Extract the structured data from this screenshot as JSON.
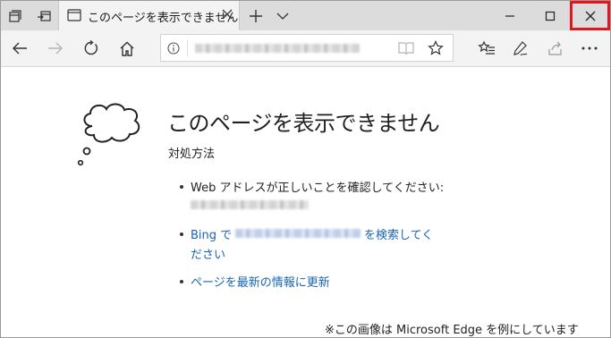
{
  "tab": {
    "title": "このページを表示できません"
  },
  "address": {
    "url": ""
  },
  "content": {
    "title": "このページを表示できません",
    "subtitle": "対処方法",
    "item1": "Web アドレスが正しいことを確認してください:",
    "item2_prefix": "Bing で",
    "item2_suffix": "を検索してく",
    "item2_line2": "ださい",
    "item3": "ページを最新の情報に更新"
  },
  "footnote": "※この画像は Microsoft Edge を例にしています",
  "colors": {
    "link": "#1764b5",
    "highlight": "#e2161e"
  },
  "icons": [
    "tab-manager-icon",
    "set-aside-tabs-icon",
    "page-icon",
    "tab-close-icon",
    "new-tab-icon",
    "tab-preview-chevron-icon",
    "minimize-icon",
    "maximize-icon",
    "close-icon",
    "back-icon",
    "forward-icon",
    "refresh-icon",
    "home-icon",
    "info-icon",
    "reading-view-icon",
    "favorite-star-icon",
    "favorites-hub-icon",
    "web-note-icon",
    "share-icon",
    "more-icon",
    "thought-cloud-icon"
  ]
}
